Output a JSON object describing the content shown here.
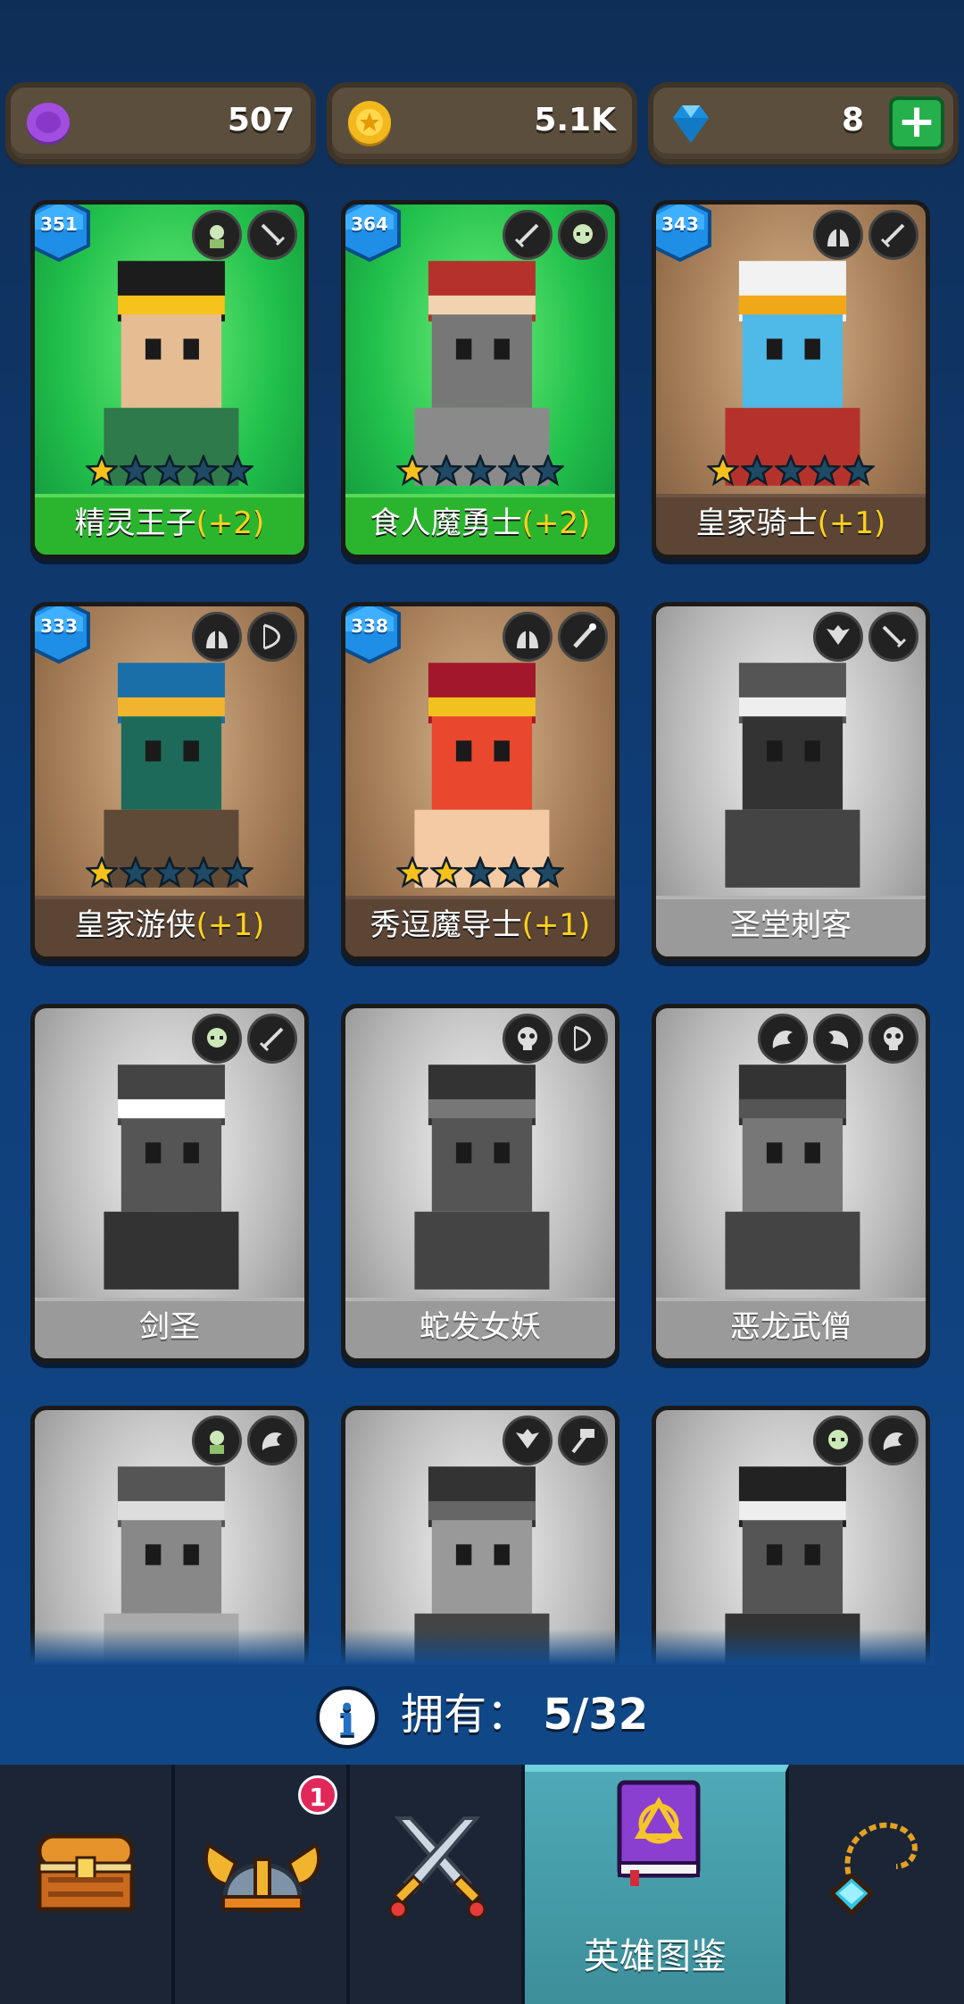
{
  "currency": {
    "purple": "507",
    "gold": "5.1K",
    "gems": "8",
    "plus": "+"
  },
  "heroes": [
    {
      "name": "精灵王子",
      "bonus": "(+2)",
      "level": "351",
      "stars": 1,
      "bg": "green"
    },
    {
      "name": "食人魔勇士",
      "bonus": "(+2)",
      "level": "364",
      "stars": 1,
      "bg": "green"
    },
    {
      "name": "皇家骑士",
      "bonus": "(+1)",
      "level": "343",
      "stars": 1,
      "bg": "tan"
    },
    {
      "name": "皇家游侠",
      "bonus": "(+1)",
      "level": "333",
      "stars": 1,
      "bg": "tan"
    },
    {
      "name": "秀逗魔导士",
      "bonus": "(+1)",
      "level": "338",
      "stars": 2,
      "bg": "tan"
    },
    {
      "name": "圣堂刺客",
      "bonus": "",
      "level": "",
      "stars": 0,
      "bg": "gray"
    },
    {
      "name": "剑圣",
      "bonus": "",
      "level": "",
      "stars": 0,
      "bg": "gray"
    },
    {
      "name": "蛇发女妖",
      "bonus": "",
      "level": "",
      "stars": 0,
      "bg": "gray"
    },
    {
      "name": "恶龙武僧",
      "bonus": "",
      "level": "",
      "stars": 0,
      "bg": "gray"
    },
    {
      "name": "",
      "bonus": "",
      "level": "",
      "stars": 0,
      "bg": "gray"
    },
    {
      "name": "",
      "bonus": "",
      "level": "",
      "stars": 0,
      "bg": "gray"
    },
    {
      "name": "",
      "bonus": "",
      "level": "",
      "stars": 0,
      "bg": "gray"
    }
  ],
  "owned": {
    "label": "拥有：",
    "count": "5/32",
    "info": "i"
  },
  "nav": {
    "active_label": "英雄图鉴",
    "notification": "1"
  },
  "colors": {
    "green_card": "#22c14c",
    "tan_card": "#a27a55",
    "gray_card": "#b8b8b8",
    "bonus": "#ffd21a",
    "level_badge": "#1f8ee6"
  }
}
